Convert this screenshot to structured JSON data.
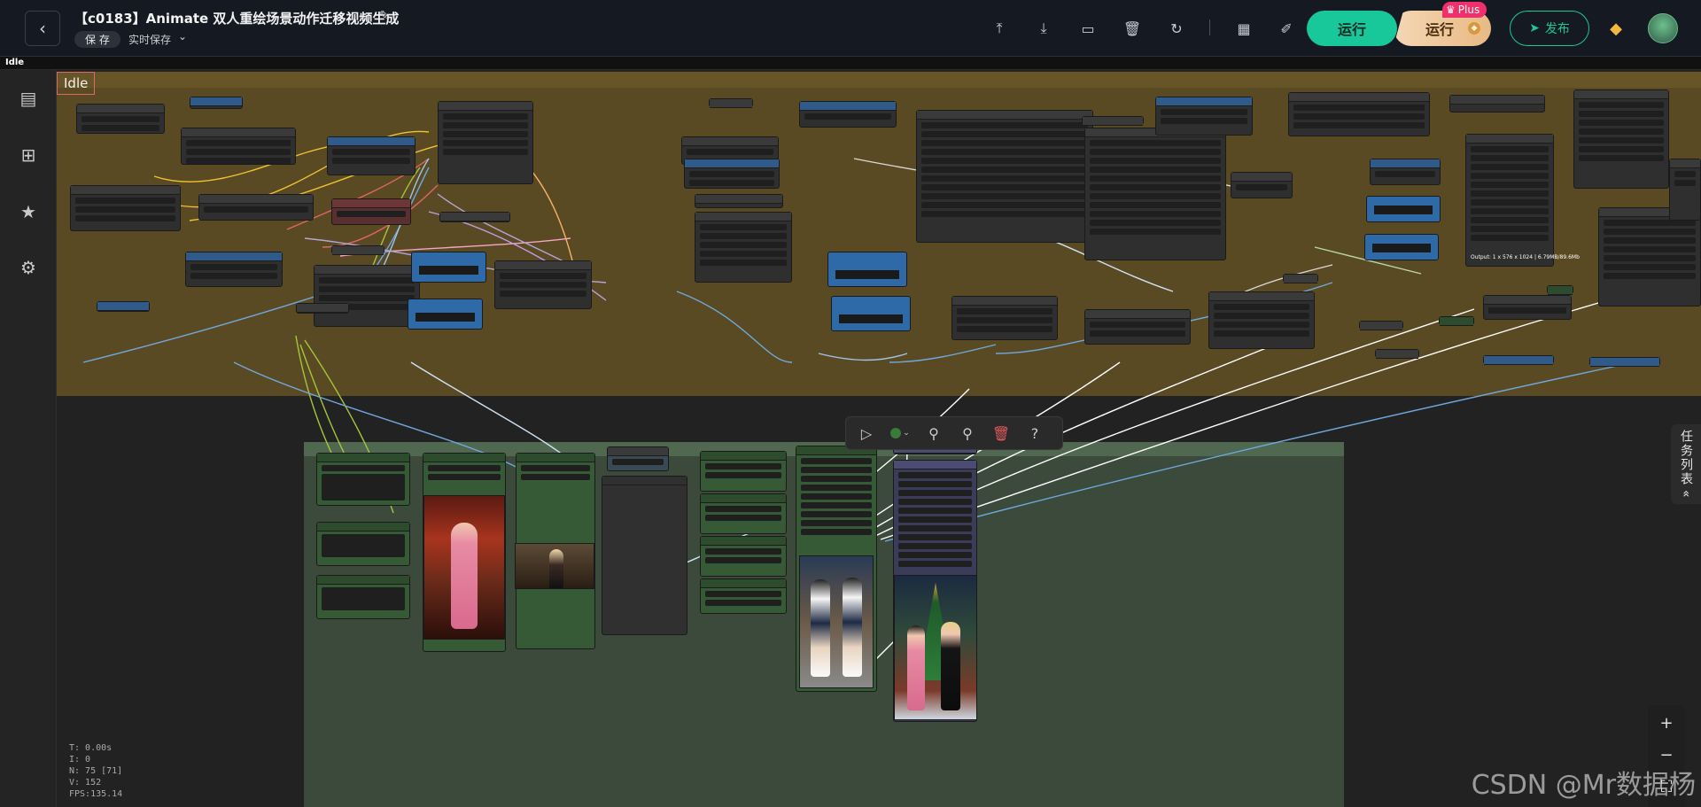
{
  "header": {
    "back_icon": "chevron-left-icon",
    "title": "【c0183】Animate 双人重绘场景动作迁移视频生成",
    "edit_icon": "pencil-icon",
    "save_label": "保 存",
    "autosave_label": "实时保存",
    "toolbar_icons": [
      "upload-icon",
      "download-icon",
      "export-icon",
      "trash-icon",
      "refresh-icon",
      "grid-icon",
      "edit-note-icon"
    ],
    "run_label": "运行",
    "run_plus_label": "运行",
    "plus_badge": "Plus",
    "publish_label": "发布"
  },
  "status": {
    "text": "Idle"
  },
  "canvas": {
    "idle_label": "Idle",
    "output_caption": "Output: 1 x 576 x 1024 | 6.79MB/89.6Mb"
  },
  "sidebar": {
    "icons": [
      "document-icon",
      "sitemap-icon",
      "star-icon",
      "settings-icon"
    ]
  },
  "floating_toolbar": {
    "icons": [
      "play-icon",
      "color-dot-icon",
      "magic-icon",
      "pin-icon",
      "delete-icon",
      "help-icon"
    ]
  },
  "stats": {
    "t": "T: 0.00s",
    "i": "I: 0",
    "n": "N: 75 [71]",
    "v": "V: 152",
    "fps": "FPS:135.14"
  },
  "task_list": {
    "label": "任务列表"
  },
  "zoom_controls": {
    "icons": [
      "zoom-in-icon",
      "zoom-out-icon",
      "fit-view-icon",
      "locate-icon"
    ]
  },
  "watermark": "CSDN @Mr数据杨",
  "colors": {
    "run": "#18c79a",
    "plus": "#f0306a",
    "group_top": "#5e4d24",
    "group_bottom": "#3b4a3b"
  }
}
